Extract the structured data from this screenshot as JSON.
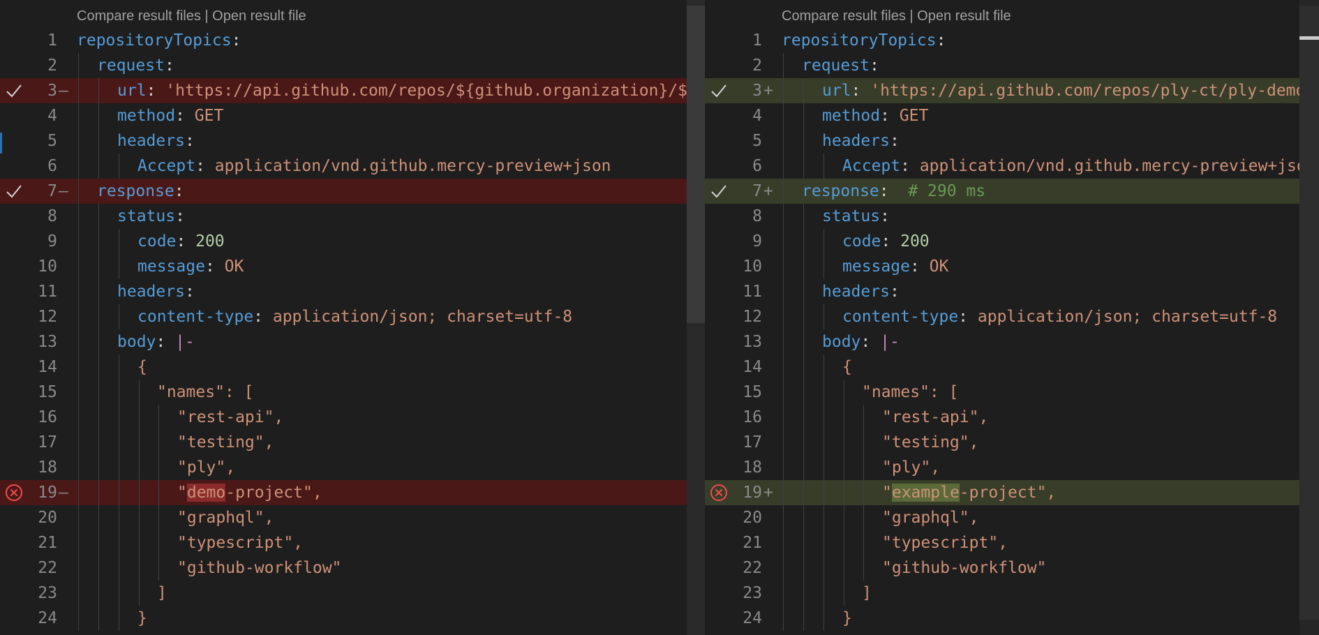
{
  "codelens": {
    "compare_label": "Compare result files",
    "separator": " | ",
    "open_label": "Open result file"
  },
  "left": {
    "lines": [
      {
        "num": "1",
        "marker": "",
        "status": "",
        "icon": ""
      },
      {
        "num": "2",
        "marker": "",
        "status": "",
        "icon": ""
      },
      {
        "num": "3",
        "marker": "—",
        "status": "removed",
        "icon": "check-icon"
      },
      {
        "num": "4",
        "marker": "",
        "status": "",
        "icon": ""
      },
      {
        "num": "5",
        "marker": "",
        "status": "",
        "icon": ""
      },
      {
        "num": "6",
        "marker": "",
        "status": "",
        "icon": ""
      },
      {
        "num": "7",
        "marker": "—",
        "status": "removed",
        "icon": "check-icon"
      },
      {
        "num": "8",
        "marker": "",
        "status": "",
        "icon": ""
      },
      {
        "num": "9",
        "marker": "",
        "status": "",
        "icon": ""
      },
      {
        "num": "10",
        "marker": "",
        "status": "",
        "icon": ""
      },
      {
        "num": "11",
        "marker": "",
        "status": "",
        "icon": ""
      },
      {
        "num": "12",
        "marker": "",
        "status": "",
        "icon": ""
      },
      {
        "num": "13",
        "marker": "",
        "status": "",
        "icon": ""
      },
      {
        "num": "14",
        "marker": "",
        "status": "",
        "icon": ""
      },
      {
        "num": "15",
        "marker": "",
        "status": "",
        "icon": ""
      },
      {
        "num": "16",
        "marker": "",
        "status": "",
        "icon": ""
      },
      {
        "num": "17",
        "marker": "",
        "status": "",
        "icon": ""
      },
      {
        "num": "18",
        "marker": "",
        "status": "",
        "icon": ""
      },
      {
        "num": "19",
        "marker": "—",
        "status": "removed",
        "icon": "error-circle-icon"
      },
      {
        "num": "20",
        "marker": "",
        "status": "",
        "icon": ""
      },
      {
        "num": "21",
        "marker": "",
        "status": "",
        "icon": ""
      },
      {
        "num": "22",
        "marker": "",
        "status": "",
        "icon": ""
      },
      {
        "num": "23",
        "marker": "",
        "status": "",
        "icon": ""
      },
      {
        "num": "24",
        "marker": "",
        "status": "",
        "icon": ""
      }
    ],
    "code": {
      "l1_key": "repositoryTopics",
      "l2_key": "request",
      "l3_key": "url",
      "l3_val": "'https://api.github.com/repos/${github.organization}/${",
      "l4_key": "method",
      "l4_val": "GET",
      "l5_key": "headers",
      "l6_key": "Accept",
      "l6_val": "application/vnd.github.mercy-preview+json",
      "l7_key": "response",
      "l8_key": "status",
      "l9_key": "code",
      "l9_val": "200",
      "l10_key": "message",
      "l10_val": "OK",
      "l11_key": "headers",
      "l12_key": "content-type",
      "l12_val": "application/json; charset=utf-8",
      "l13_key": "body",
      "l13_val": "|-",
      "l14": "{",
      "l15": "\"names\": [",
      "l16": "\"rest-api\",",
      "l17": "\"testing\",",
      "l18": "\"ply\",",
      "l19_pre": "\"",
      "l19_hl": "demo",
      "l19_post": "-project\",",
      "l20": "\"graphql\",",
      "l21": "\"typescript\",",
      "l22": "\"github-workflow\"",
      "l23": "]",
      "l24": "}"
    }
  },
  "right": {
    "lines": [
      {
        "num": "1",
        "marker": "",
        "status": "",
        "icon": ""
      },
      {
        "num": "2",
        "marker": "",
        "status": "",
        "icon": ""
      },
      {
        "num": "3",
        "marker": "+",
        "status": "added",
        "icon": "check-icon"
      },
      {
        "num": "4",
        "marker": "",
        "status": "",
        "icon": ""
      },
      {
        "num": "5",
        "marker": "",
        "status": "",
        "icon": ""
      },
      {
        "num": "6",
        "marker": "",
        "status": "",
        "icon": ""
      },
      {
        "num": "7",
        "marker": "+",
        "status": "added",
        "icon": "check-icon"
      },
      {
        "num": "8",
        "marker": "",
        "status": "",
        "icon": ""
      },
      {
        "num": "9",
        "marker": "",
        "status": "",
        "icon": ""
      },
      {
        "num": "10",
        "marker": "",
        "status": "",
        "icon": ""
      },
      {
        "num": "11",
        "marker": "",
        "status": "",
        "icon": ""
      },
      {
        "num": "12",
        "marker": "",
        "status": "",
        "icon": ""
      },
      {
        "num": "13",
        "marker": "",
        "status": "",
        "icon": ""
      },
      {
        "num": "14",
        "marker": "",
        "status": "",
        "icon": ""
      },
      {
        "num": "15",
        "marker": "",
        "status": "",
        "icon": ""
      },
      {
        "num": "16",
        "marker": "",
        "status": "",
        "icon": ""
      },
      {
        "num": "17",
        "marker": "",
        "status": "",
        "icon": ""
      },
      {
        "num": "18",
        "marker": "",
        "status": "",
        "icon": ""
      },
      {
        "num": "19",
        "marker": "+",
        "status": "added",
        "icon": "error-circle-icon"
      },
      {
        "num": "20",
        "marker": "",
        "status": "",
        "icon": ""
      },
      {
        "num": "21",
        "marker": "",
        "status": "",
        "icon": ""
      },
      {
        "num": "22",
        "marker": "",
        "status": "",
        "icon": ""
      },
      {
        "num": "23",
        "marker": "",
        "status": "",
        "icon": ""
      },
      {
        "num": "24",
        "marker": "",
        "status": "",
        "icon": ""
      }
    ],
    "code": {
      "l1_key": "repositoryTopics",
      "l2_key": "request",
      "l3_key": "url",
      "l3_val": "'https://api.github.com/repos/ply-ct/ply-demo",
      "l4_key": "method",
      "l4_val": "GET",
      "l5_key": "headers",
      "l6_key": "Accept",
      "l6_val": "application/vnd.github.mercy-preview+json",
      "l7_key": "response",
      "l7_comment": "# 290 ms",
      "l8_key": "status",
      "l9_key": "code",
      "l9_val": "200",
      "l10_key": "message",
      "l10_val": "OK",
      "l11_key": "headers",
      "l12_key": "content-type",
      "l12_val": "application/json; charset=utf-8",
      "l13_key": "body",
      "l13_val": "|-",
      "l14": "{",
      "l15": "\"names\": [",
      "l16": "\"rest-api\",",
      "l17": "\"testing\",",
      "l18": "\"ply\",",
      "l19_pre": "\"",
      "l19_hl": "example",
      "l19_post": "-project\",",
      "l20": "\"graphql\",",
      "l21": "\"typescript\",",
      "l22": "\"github-workflow\"",
      "l23": "]",
      "l24": "}"
    }
  },
  "colors": {
    "removed_bg": "#4b1818",
    "added_bg": "#373d29",
    "key": "#569cd6",
    "string": "#ce9178",
    "number": "#b5cea8",
    "comment": "#6a9955"
  }
}
